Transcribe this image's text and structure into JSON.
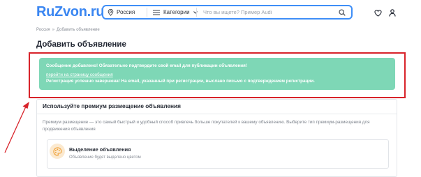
{
  "header": {
    "logo": "RuZvon.ru",
    "region": "Россия",
    "categories": "Категории",
    "search_placeholder": "Что вы ищете? Пример Audi"
  },
  "breadcrumb": {
    "home": "Россия",
    "separator": "»",
    "current": "Добавить объявление"
  },
  "page_title": "Добавить объявление",
  "alert": {
    "message": "Сообщение добавлено! Обязательно подтвердите свой email для публикации объявления!",
    "link": "перейти на страницу сообщения",
    "registration": "Регистрация успешно завершена! На email, указанный при регистрации, выслано письмо с подтверждением регистрации."
  },
  "premium": {
    "title": "Используйте премиум размещение объявления",
    "description": "Премиум размещение — это самый быстрый и удобный способ привлечь больше покупателей к вашему объявлению. Выберите тип премиум-размещения для продвижения объявления",
    "option": {
      "title": "Выделение объявления",
      "description": "Объявление будет выделено цветом"
    }
  },
  "colors": {
    "brand": "#3a86f1",
    "alert_bg": "#7ed7b6",
    "annotation": "#d8232a"
  }
}
